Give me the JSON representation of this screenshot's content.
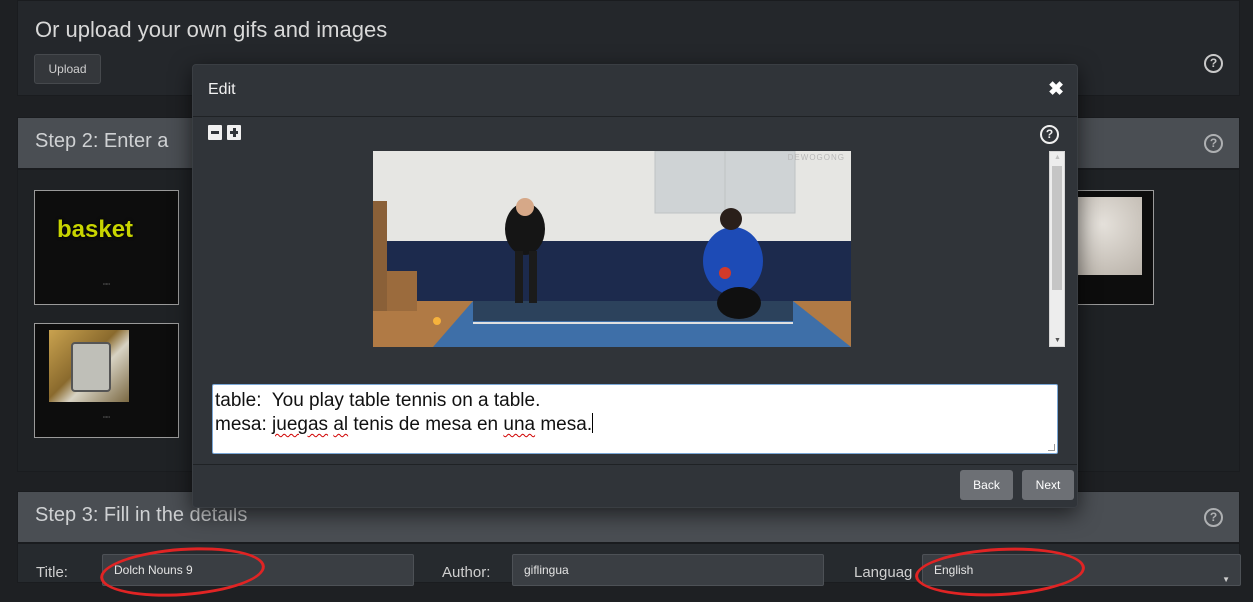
{
  "upload": {
    "heading": "Or upload your own gifs and images",
    "button": "Upload",
    "help": "?"
  },
  "step2": {
    "title": "Step 2: Enter a",
    "help": "?",
    "thumbnails": [
      {
        "word": "basket"
      },
      {
        "word": ""
      },
      {
        "word": ""
      }
    ]
  },
  "step3": {
    "title": "Step 3: Fill in the details",
    "help": "?"
  },
  "details": {
    "title_label": "Title:",
    "title_value": "Dolch Nouns 9",
    "author_label": "Author:",
    "author_value": "giflingua",
    "language_label": "Languag",
    "language_value": "English",
    "language_arrow": "▼"
  },
  "modal": {
    "title": "Edit",
    "close": "✖",
    "help": "?",
    "watermark": "DEWOGONG",
    "scroll_up": "▲",
    "scroll_down": "▼",
    "caption": {
      "line1": "table:  You play table tennis on a table.",
      "line2_prefix": "mesa: ",
      "line2_words": [
        "juegas",
        " ",
        "al",
        " tenis de mesa en ",
        "una",
        " mesa."
      ]
    },
    "back": "Back",
    "next": "Next"
  }
}
